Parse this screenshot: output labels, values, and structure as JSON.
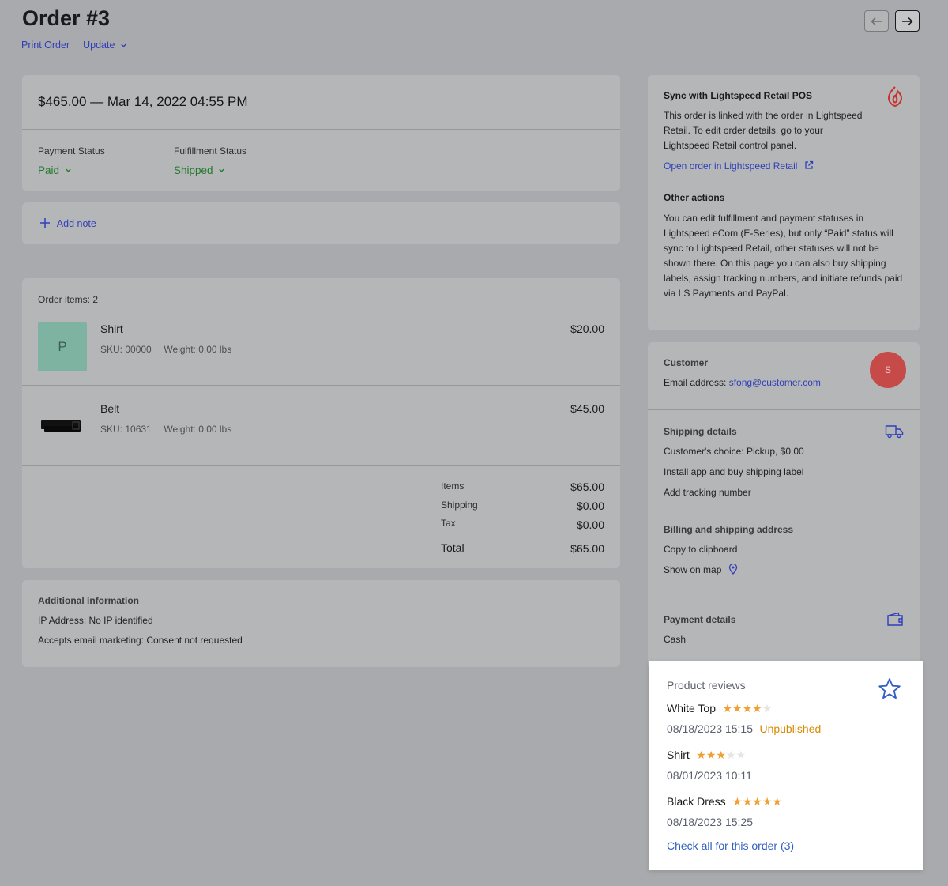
{
  "header": {
    "title": "Order #3",
    "print_label": "Print Order",
    "update_label": "Update"
  },
  "summary": {
    "headline": "$465.00 — Mar 14, 2022 04:55 PM",
    "payment_status_label": "Payment Status",
    "payment_status_value": "Paid",
    "fulfillment_status_label": "Fulfillment Status",
    "fulfillment_status_value": "Shipped"
  },
  "note": {
    "add_label": "Add note"
  },
  "items": {
    "count_label": "Order items: 2",
    "list": [
      {
        "name": "Shirt",
        "sku": "SKU: 00000",
        "weight": "Weight: 0.00 lbs",
        "price": "$20.00",
        "thumb_letter": "P"
      },
      {
        "name": "Belt",
        "sku": "SKU: 10631",
        "weight": "Weight: 0.00 lbs",
        "price": "$45.00"
      }
    ],
    "totals": [
      {
        "label": "Items",
        "value": "$65.00"
      },
      {
        "label": "Shipping",
        "value": "$0.00"
      },
      {
        "label": "Tax",
        "value": "$0.00"
      }
    ],
    "total_label": "Total",
    "total_value": "$65.00"
  },
  "additional": {
    "title": "Additional information",
    "ip": "IP Address: No IP identified",
    "marketing": "Accepts email marketing: Consent not requested"
  },
  "sync": {
    "title": "Sync with Lightspeed Retail POS",
    "lines": [
      "This order is linked with the order in Lightspeed",
      "Retail. To edit order details, go to your",
      "Lightspeed Retail control panel."
    ],
    "open_link": "Open order in Lightspeed Retail",
    "other_title": "Other actions",
    "other_lines": [
      "You can edit fulfillment and payment statuses in",
      "Lightspeed eCom (E-Series), but only “Paid” status will",
      "sync to Lightspeed Retail, other statuses will not be",
      "shown there. On this page you can also buy shipping",
      "labels, assign tracking numbers, and initiate refunds paid",
      "via LS Payments and PayPal."
    ]
  },
  "customer": {
    "title": "Customer",
    "email_prefix": "Email address: ",
    "email": "sfong@customer.com",
    "avatar_letter": "S"
  },
  "shipping": {
    "title": "Shipping details",
    "choice": "Customer's choice: Pickup, $0.00",
    "install_link": "Install app and buy shipping label",
    "tracking_link": "Add tracking number",
    "address_title": "Billing and shipping address",
    "copy_link": "Copy to clipboard",
    "map_link": "Show on map"
  },
  "payment": {
    "title": "Payment details",
    "method": "Cash"
  },
  "reviews": {
    "title": "Product reviews",
    "list": [
      {
        "name": "White Top",
        "rating": 4,
        "date": "08/18/2023  15:15",
        "status": "Unpublished"
      },
      {
        "name": "Shirt",
        "rating": 3,
        "date": "08/01/2023  10:11",
        "status": ""
      },
      {
        "name": "Black Dress",
        "rating": 5,
        "date": "08/18/2023  15:25",
        "status": ""
      }
    ],
    "check_all": "Check all for this order (3)"
  }
}
